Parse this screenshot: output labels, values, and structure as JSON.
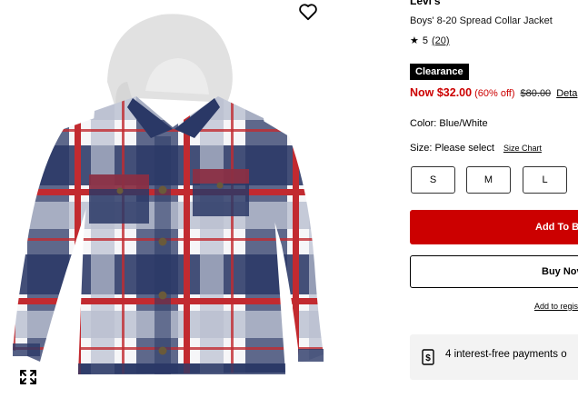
{
  "icons": {
    "wishlist": "heart-icon",
    "expand": "expand-arrows-icon",
    "rating": "star-icon",
    "installments": "dollar-sign-icon"
  },
  "colors": {
    "accent_red": "#cc0000",
    "badge_bg": "#000000",
    "navy": "#25335f",
    "plaid_red": "#c22a30",
    "hood_grey": "#e1e1e1"
  },
  "product": {
    "brand": "Levi's",
    "title": "Boys' 8-20 Spread Collar Jacket",
    "rating_value": "5",
    "review_count": "(20)",
    "badge": "Clearance",
    "price_now": "Now $32.00",
    "discount": "(60% off)",
    "price_was": "$80.00",
    "details_link": "Deta",
    "color_label": "Color: Blue/White",
    "size_label": "Size: Please select",
    "size_chart": "Size Chart",
    "sizes": [
      "S",
      "M",
      "L"
    ]
  },
  "actions": {
    "add_to_bag": "Add To Ba",
    "buy_now": "Buy Nov",
    "add_to_registry": "Add to regis"
  },
  "installments": {
    "text": "4 interest-free payments o"
  }
}
